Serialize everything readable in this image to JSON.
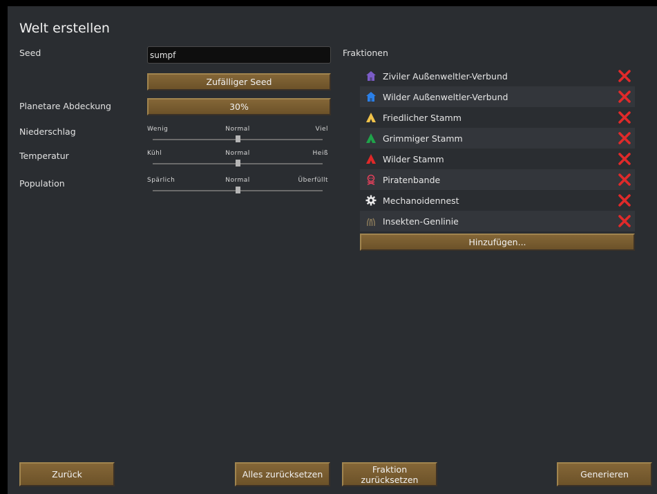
{
  "title": "Welt erstellen",
  "seed": {
    "label": "Seed",
    "value": "sumpf",
    "random_button": "Zufälliger Seed"
  },
  "coverage": {
    "label": "Planetare Abdeckung",
    "value": "30%"
  },
  "rainfall": {
    "label": "Niederschlag",
    "left": "Wenig",
    "mid": "Normal",
    "right": "Viel",
    "level": 0.5
  },
  "temperature": {
    "label": "Temperatur",
    "left": "Kühl",
    "mid": "Normal",
    "right": "Heiß",
    "level": 0.5
  },
  "population": {
    "label": "Population",
    "left": "Spärlich",
    "mid": "Normal",
    "right": "Überfüllt",
    "level": 0.5
  },
  "factions": {
    "title": "Fraktionen",
    "items": [
      {
        "name": "Ziviler Außenweltler-Verbund",
        "icon": "house-icon",
        "color": "#7b5cc7"
      },
      {
        "name": "Wilder Außenweltler-Verbund",
        "icon": "house-icon",
        "color": "#2a7fe8"
      },
      {
        "name": "Friedlicher Stamm",
        "icon": "tribe-tent-icon",
        "color": "#f0c24a"
      },
      {
        "name": "Grimmiger Stamm",
        "icon": "tribe-tent-icon",
        "color": "#1fa34a"
      },
      {
        "name": "Wilder Stamm",
        "icon": "tribe-tent-icon",
        "color": "#e02828"
      },
      {
        "name": "Piratenbande",
        "icon": "skull-icon",
        "color": "#e0405a"
      },
      {
        "name": "Mechanoidennest",
        "icon": "gear-icon",
        "color": "#e8e8e8"
      },
      {
        "name": "Insekten-Genlinie",
        "icon": "insect-claw-icon",
        "color": "#8a7a5a"
      }
    ],
    "add_button": "Hinzufügen...",
    "remove_color": "#e02a2a"
  },
  "footer": {
    "back": "Zurück",
    "reset_all": "Alles zurücksetzen",
    "reset_factions": "Fraktion zurücksetzen",
    "generate": "Generieren"
  }
}
